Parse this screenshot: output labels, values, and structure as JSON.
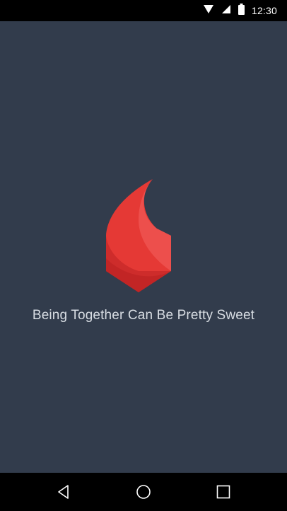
{
  "status_bar": {
    "time": "12:30",
    "icons": [
      "wifi-icon",
      "cellular-signal-icon",
      "battery-icon"
    ]
  },
  "app": {
    "tagline": "Being Together Can Be Pretty Sweet",
    "background_color": "#323c4c",
    "logo_colors": [
      "#e53935",
      "#ef5350",
      "#c62828",
      "#b71c1c"
    ]
  },
  "nav_bar": {
    "buttons": [
      "back-icon",
      "home-icon",
      "recent-apps-icon"
    ]
  }
}
